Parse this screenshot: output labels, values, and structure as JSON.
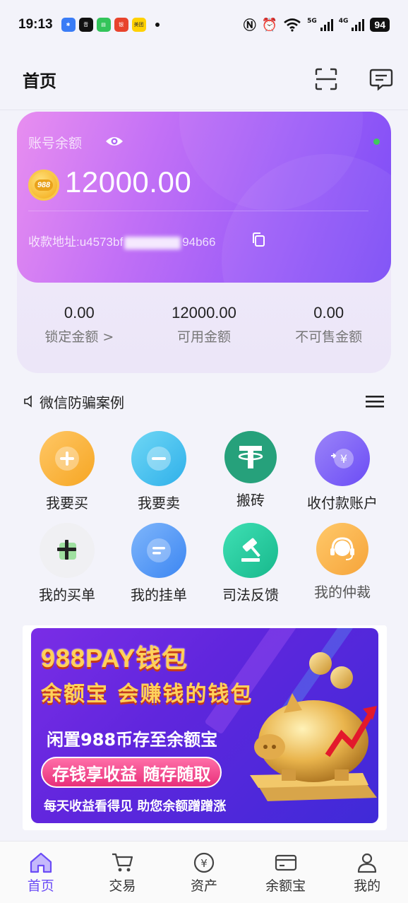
{
  "status_bar": {
    "time": "19:13",
    "apps": [
      {
        "name": "photos-app-icon",
        "color": "#3a7cf6",
        "text": "✱"
      },
      {
        "name": "app-icon-2",
        "color": "#111111",
        "text": "音"
      },
      {
        "name": "message-app-icon",
        "color": "#33c45a",
        "text": "▤"
      },
      {
        "name": "bank-app-icon",
        "color": "#e8432c",
        "text": "银"
      },
      {
        "name": "meituan-app-icon",
        "color": "#ffd100",
        "text": "美团"
      }
    ],
    "network_1": "5G",
    "network_2": "4G",
    "battery": "94"
  },
  "header": {
    "title": "首页"
  },
  "balance_card": {
    "label": "账号余额",
    "coin_text": "988",
    "amount": "12000.00",
    "address_prefix": "收款地址:u4573bf",
    "address_suffix": "94b66"
  },
  "stats": [
    {
      "value": "0.00",
      "label": "锁定金额 >"
    },
    {
      "value": "12000.00",
      "label": "可用金额"
    },
    {
      "value": "0.00",
      "label": "不可售金额"
    }
  ],
  "notice": {
    "text": "微信防骗案例"
  },
  "grid": [
    {
      "label": "我要买"
    },
    {
      "label": "我要卖"
    },
    {
      "label": "搬砖"
    },
    {
      "label": "收付款账户"
    },
    {
      "label": "我的买单"
    },
    {
      "label": "我的挂单"
    },
    {
      "label": "司法反馈"
    },
    {
      "label": "我的仲裁"
    }
  ],
  "banner": {
    "title": "988PAY钱包",
    "subtitle": "余额宝 会赚钱的钱包",
    "line3": "闲置988币存至余额宝",
    "pill": "存钱享收益 随存随取",
    "footer": "每天收益看得见 助您余额蹭蹭涨"
  },
  "tabs": [
    {
      "label": "首页",
      "active": true
    },
    {
      "label": "交易",
      "active": false
    },
    {
      "label": "资产",
      "active": false
    },
    {
      "label": "余额宝",
      "active": false
    },
    {
      "label": "我的",
      "active": false
    }
  ],
  "colors": {
    "accent": "#6b4cf6",
    "card_gradient_start": "#e88ef0",
    "card_gradient_end": "#7b4cf6"
  }
}
